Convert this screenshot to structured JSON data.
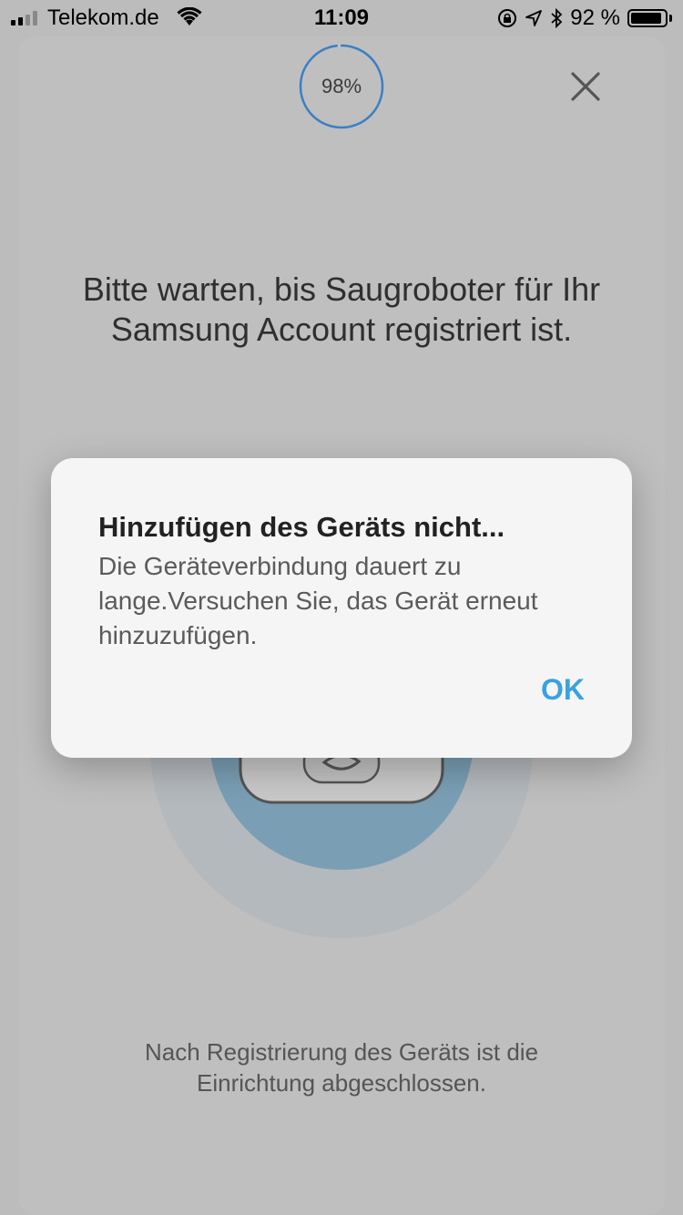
{
  "status_bar": {
    "carrier": "Telekom.de",
    "time": "11:09",
    "battery_percent": "92 %",
    "battery_level": 0.92,
    "icons": [
      "signal-icon",
      "wifi-icon",
      "orientation-lock-icon",
      "location-icon",
      "bluetooth-icon",
      "battery-icon"
    ]
  },
  "progress": {
    "label": "98%",
    "value": 0.98,
    "color": "#3a7fc4"
  },
  "header": {
    "close_icon": "close-icon"
  },
  "main": {
    "wait_message": "Bitte warten, bis Saugroboter für Ihr Samsung Account registriert ist.",
    "footer_message": "Nach Registrierung des Geräts ist die Einrichtung abgeschlossen."
  },
  "dialog": {
    "title": "Hinzufügen des Geräts nicht...",
    "message": "Die Geräteverbindung dauert zu lange.Versuchen Sie, das Gerät erneut hinzuzufügen.",
    "ok_label": "OK",
    "accent_color": "#3aa2e0"
  }
}
